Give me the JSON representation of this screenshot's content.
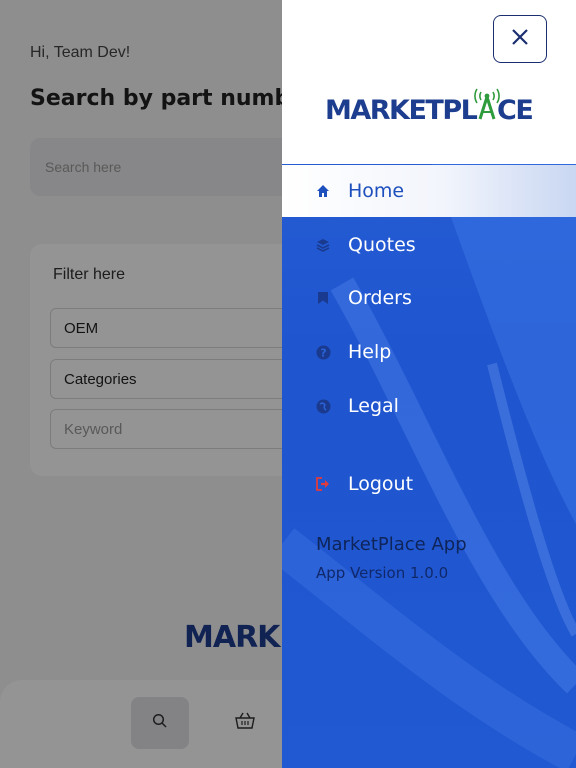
{
  "page": {
    "greeting": "Hi, Team Dev!",
    "headline": "Search by part number",
    "search_placeholder": "Search here",
    "filter": {
      "title": "Filter here",
      "oem": "OEM",
      "categories": "Categories",
      "keyword_placeholder": "Keyword"
    },
    "bottom_logo": "MARKE"
  },
  "drawer": {
    "brand_left": "MARKETPL",
    "brand_right": "CE",
    "items": [
      {
        "label": "Home",
        "icon": "home-icon",
        "active": true
      },
      {
        "label": "Quotes",
        "icon": "layers-icon",
        "active": false
      },
      {
        "label": "Orders",
        "icon": "bookmark-icon",
        "active": false
      },
      {
        "label": "Help",
        "icon": "help-icon",
        "active": false
      },
      {
        "label": "Legal",
        "icon": "globe-icon",
        "active": false
      },
      {
        "label": "Logout",
        "icon": "logout-icon",
        "active": false
      }
    ],
    "app_name": "MarketPlace App",
    "app_version": "App Version 1.0.0"
  },
  "colors": {
    "drawer_blue": "#2159d2",
    "brand_navy": "#1d3d8f",
    "brand_green": "#2e9b3c",
    "logout_red": "#e23b3b"
  }
}
